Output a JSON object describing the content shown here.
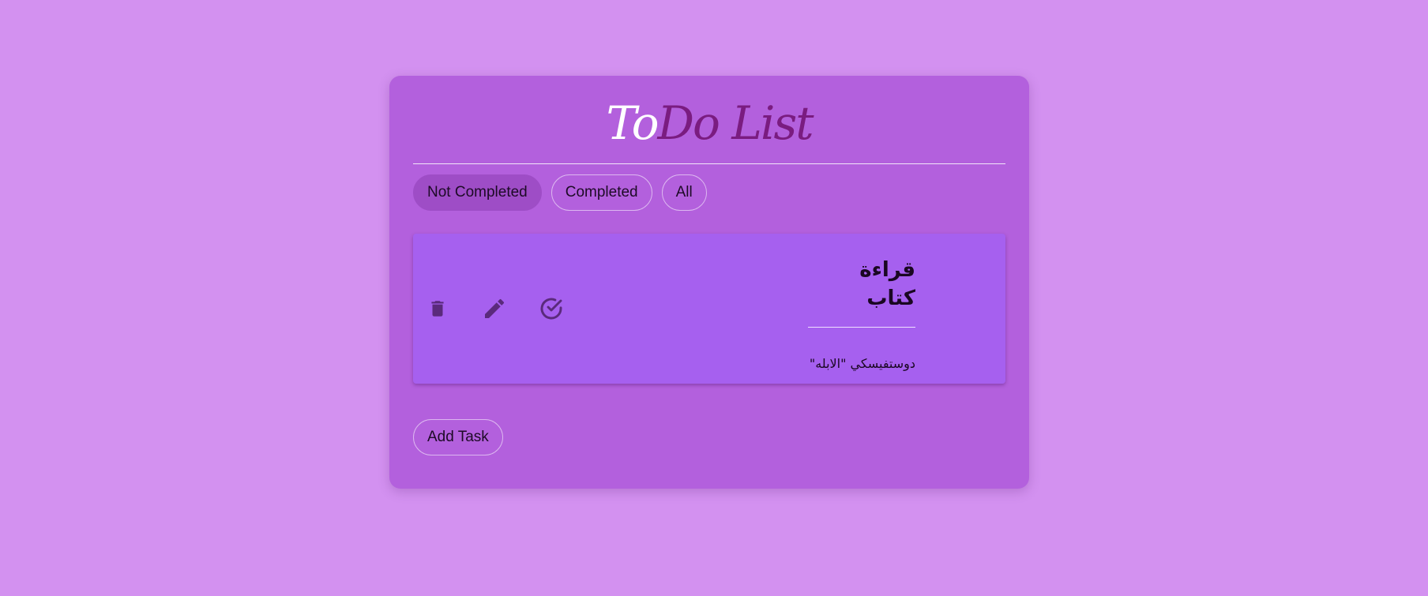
{
  "app": {
    "title_part_a": "To",
    "title_part_b": "Do List"
  },
  "filters": [
    {
      "label": "Not Completed",
      "active": true
    },
    {
      "label": "Completed",
      "active": false
    },
    {
      "label": "All",
      "active": false
    }
  ],
  "tasks": [
    {
      "title": "قراءة كتاب",
      "description": "دوستفيسكي \"الابله\""
    }
  ],
  "actions": {
    "add_task_label": "Add Task"
  },
  "icons": {
    "delete": "trash-icon",
    "edit": "pencil-icon",
    "complete": "check-circle-icon"
  },
  "colors": {
    "background": "#d391f0",
    "card": "#b360dd",
    "task_card": "#a660ef",
    "active_chip": "#9e4dc6",
    "icon": "#5a2a7c",
    "title_accent": "#7a1c80"
  }
}
